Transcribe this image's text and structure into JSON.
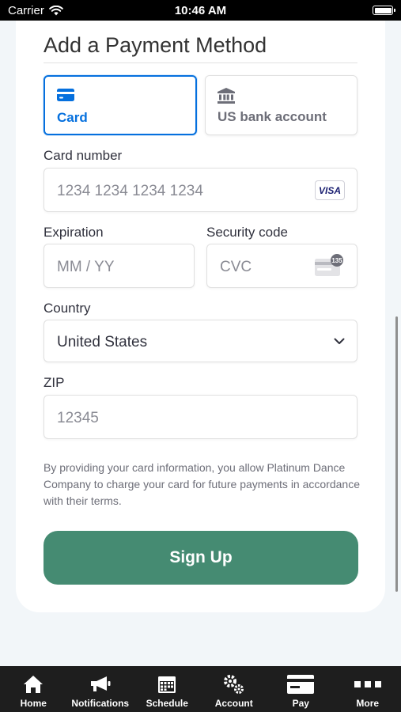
{
  "status_bar": {
    "carrier": "Carrier",
    "time": "10:46 AM"
  },
  "form": {
    "title": "Add a Payment Method",
    "tabs": [
      {
        "label": "Card",
        "icon": "credit-card-icon",
        "selected": true
      },
      {
        "label": "US bank account",
        "icon": "bank-icon",
        "selected": false
      }
    ],
    "card_number": {
      "label": "Card number",
      "placeholder": "1234 1234 1234 1234",
      "brand_badge": "VISA"
    },
    "expiration": {
      "label": "Expiration",
      "placeholder": "MM / YY"
    },
    "security_code": {
      "label": "Security code",
      "placeholder": "CVC",
      "cvc_badge": "135"
    },
    "country": {
      "label": "Country",
      "value": "United States"
    },
    "zip": {
      "label": "ZIP",
      "placeholder": "12345"
    },
    "consent_text": "By providing your card information, you allow Platinum Dance Company to charge your card for future payments in accordance with their terms.",
    "submit_label": "Sign Up"
  },
  "colors": {
    "accent_blue": "#0570de",
    "button_green": "#458b72",
    "tabbar_bg": "#1e1e1e"
  },
  "tabbar": {
    "items": [
      {
        "label": "Home",
        "icon": "home-icon"
      },
      {
        "label": "Notifications",
        "icon": "megaphone-icon"
      },
      {
        "label": "Schedule",
        "icon": "calendar-icon"
      },
      {
        "label": "Account",
        "icon": "gears-icon"
      },
      {
        "label": "Pay",
        "icon": "credit-card-icon"
      },
      {
        "label": "More",
        "icon": "ellipsis-icon"
      }
    ]
  }
}
